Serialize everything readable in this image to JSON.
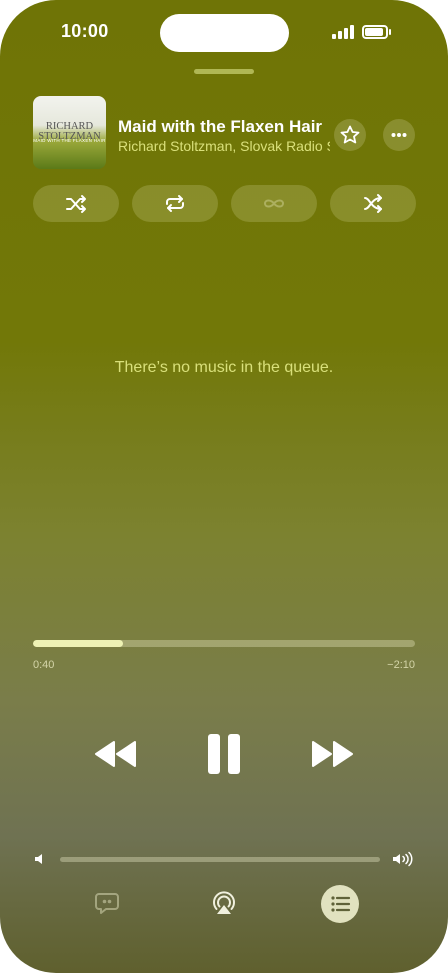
{
  "status_bar": {
    "time": "10:00"
  },
  "now_playing": {
    "artwork_text": {
      "line1": "RICHARD",
      "line2": "STOLTZMAN",
      "line3": "MAID WITH THE FLAXEN HAIR"
    },
    "title": "Maid with the Flaxen Hair",
    "artist": "Richard Stoltzman, Slovak Radio Symphony Orchestra"
  },
  "header_buttons": {
    "favorite_icon": "star-icon",
    "more_icon": "ellipsis-icon"
  },
  "playback_modes": [
    {
      "icon": "shuffle-icon",
      "enabled": true
    },
    {
      "icon": "repeat-icon",
      "enabled": true
    },
    {
      "icon": "infinity-icon",
      "enabled": false
    },
    {
      "icon": "crossfade-icon",
      "enabled": true
    }
  ],
  "queue": {
    "empty_message": "There’s no music in the queue."
  },
  "progress": {
    "elapsed": "0:40",
    "remaining": "−2:10",
    "fraction": 0.235
  },
  "controls": {
    "previous_icon": "rewind-icon",
    "play_pause_icon": "pause-icon",
    "next_icon": "fast-forward-icon"
  },
  "volume": {
    "level": 1.0,
    "low_icon": "speaker-icon",
    "high_icon": "speaker-wave-icon"
  },
  "bottom_bar": [
    {
      "icon": "lyrics-icon",
      "active": false
    },
    {
      "icon": "airplay-icon",
      "active": false
    },
    {
      "icon": "queue-list-icon",
      "active": true
    }
  ],
  "colors": {
    "background": "#727808",
    "accent_text": "#d9e07a",
    "progress_fill": "#eef2b4"
  }
}
